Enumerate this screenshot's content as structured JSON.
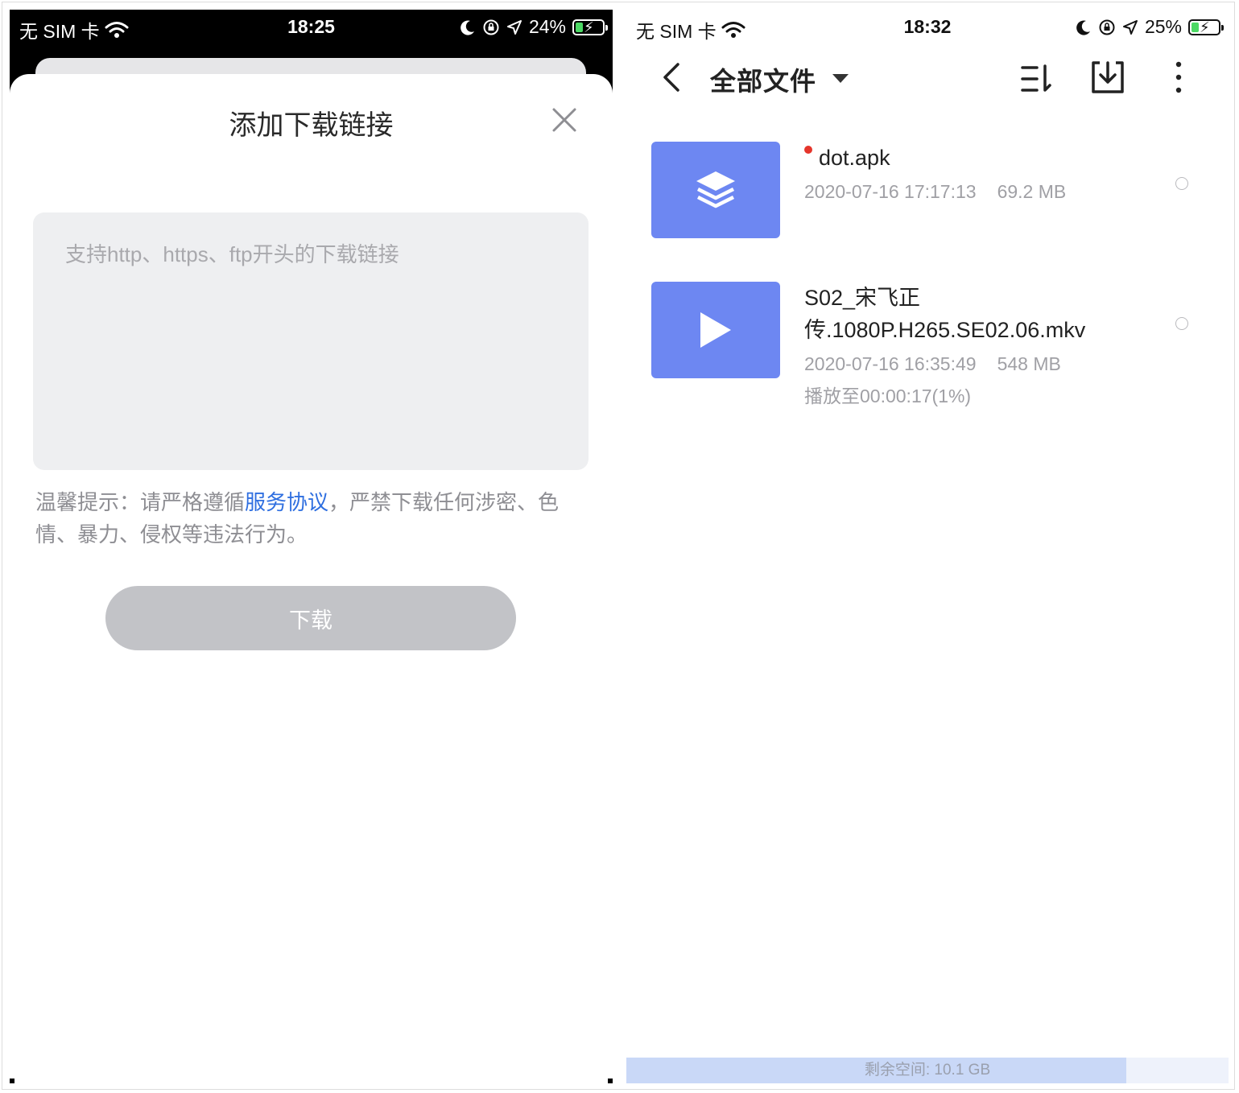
{
  "left": {
    "status": {
      "carrier": "无 SIM 卡",
      "time": "18:25",
      "battery": "24%",
      "battery_level": 0.24
    },
    "dialog": {
      "title": "添加下载链接",
      "input_placeholder": "支持http、https、ftp开头的下载链接",
      "input_value": "",
      "tip_prefix": "温馨提示：请严格遵循",
      "tip_link": "服务协议",
      "tip_suffix": "，严禁下载任何涉密、色情、暴力、侵权等违法行为。",
      "download_label": "下载"
    },
    "icons": {
      "wifi": "wifi-icon",
      "moon": "moon-icon",
      "lock": "rotation-lock-icon",
      "location": "location-arrow-icon",
      "close": "close-icon"
    }
  },
  "right": {
    "status": {
      "carrier": "无 SIM 卡",
      "time": "18:32",
      "battery": "25%",
      "battery_level": 0.25
    },
    "nav": {
      "title": "全部文件"
    },
    "files": [
      {
        "name": "dot.apk",
        "date": "2020-07-16 17:17:13",
        "size": "69.2 MB",
        "new": true,
        "icon": "layers-icon"
      },
      {
        "name_line1": "S02_宋飞正",
        "name_line2": "传.1080P.H265.SE02.06.mkv",
        "date": "2020-07-16 16:35:49",
        "size": "548 MB",
        "progress": "播放至00:00:17(1%)",
        "icon": "play-icon"
      }
    ],
    "storage": {
      "label": "剩余空间: 10.1 GB",
      "used_fraction": 0.83
    },
    "colors": {
      "thumb": "#6d87f2",
      "link": "#2f6fe0",
      "new_dot": "#e5352b"
    }
  }
}
